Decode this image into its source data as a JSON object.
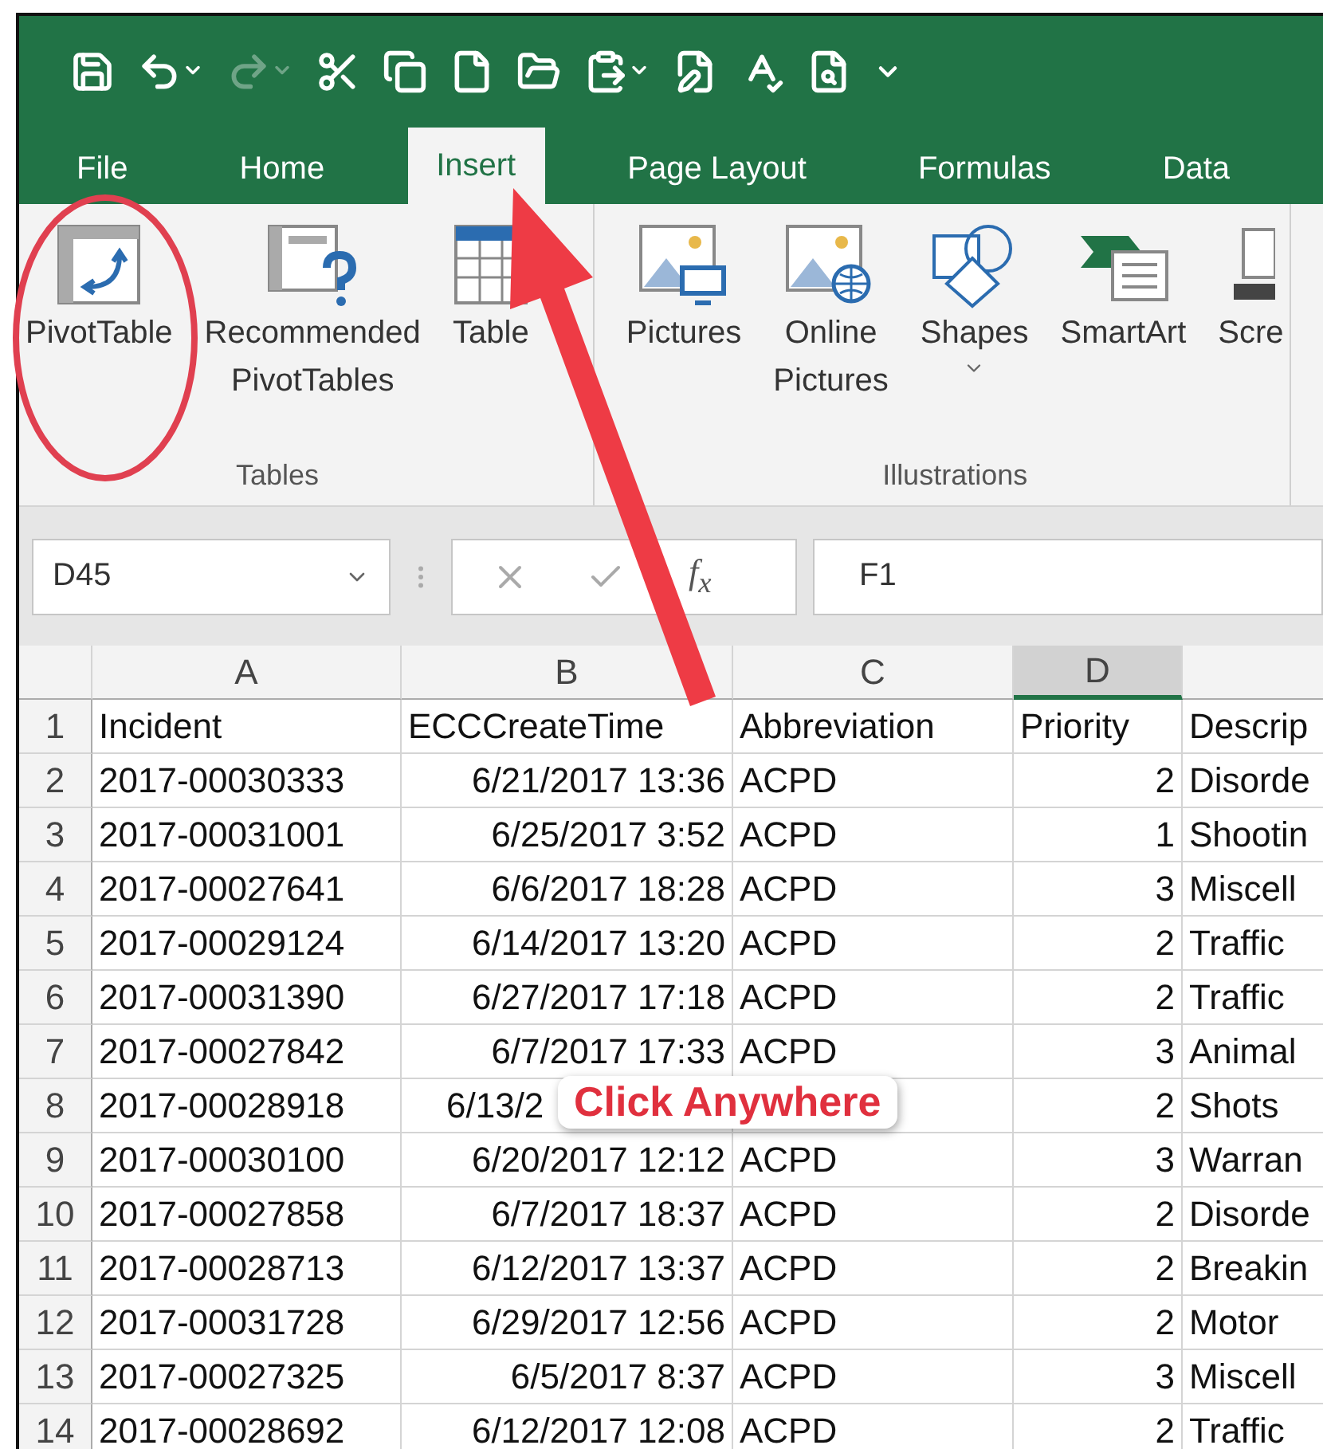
{
  "quick_access": [
    {
      "kind": "save",
      "disabled": false
    },
    {
      "kind": "undo",
      "disabled": false
    },
    {
      "kind": "redo",
      "disabled": true
    },
    {
      "kind": "cut",
      "disabled": false
    },
    {
      "kind": "copy",
      "disabled": false
    },
    {
      "kind": "new",
      "disabled": false
    },
    {
      "kind": "open",
      "disabled": false
    },
    {
      "kind": "paste",
      "disabled": false
    },
    {
      "kind": "form",
      "disabled": false
    },
    {
      "kind": "spelling",
      "disabled": false
    },
    {
      "kind": "preview",
      "disabled": false
    },
    {
      "kind": "customize",
      "disabled": false
    }
  ],
  "tabs": [
    {
      "label": "File",
      "selected": false
    },
    {
      "label": "Home",
      "selected": false
    },
    {
      "label": "Insert",
      "selected": true
    },
    {
      "label": "Page Layout",
      "selected": false
    },
    {
      "label": "Formulas",
      "selected": false
    },
    {
      "label": "Data",
      "selected": false
    }
  ],
  "ribbon": {
    "groups": [
      {
        "label": "Tables",
        "commands": [
          {
            "kind": "pivot",
            "lines": [
              "PivotTable"
            ],
            "dropdown": false
          },
          {
            "kind": "recommended",
            "lines": [
              "Recommended",
              "PivotTables"
            ],
            "dropdown": false
          },
          {
            "kind": "table",
            "lines": [
              "Table"
            ],
            "dropdown": false
          }
        ]
      },
      {
        "label": "Illustrations",
        "commands": [
          {
            "kind": "pictures",
            "lines": [
              "Pictures"
            ],
            "dropdown": false
          },
          {
            "kind": "online",
            "lines": [
              "Online",
              "Pictures"
            ],
            "dropdown": false
          },
          {
            "kind": "shapes",
            "lines": [
              "Shapes"
            ],
            "dropdown": true
          },
          {
            "kind": "smartart",
            "lines": [
              "SmartArt"
            ],
            "dropdown": false
          },
          {
            "kind": "screenshot",
            "lines": [
              "Scre"
            ],
            "dropdown": false
          }
        ]
      }
    ]
  },
  "formula_bar": {
    "name_box": "D45",
    "function_label": "f$_{x}$",
    "value": "F1"
  },
  "sheet": {
    "columns": [
      {
        "label": "A",
        "selected": false
      },
      {
        "label": "B",
        "selected": false
      },
      {
        "label": "C",
        "selected": false
      },
      {
        "label": "D",
        "selected": true
      }
    ],
    "rows": [
      {
        "number": "1",
        "kind": "header",
        "cells": [
          "Incident",
          "ECCCreateTime",
          "Abbreviation",
          "Priority",
          "Descrip"
        ]
      },
      {
        "number": "2",
        "kind": "data",
        "cells": [
          "2017-00030333",
          "6/21/2017 13:36",
          "ACPD",
          "2",
          "Disorde"
        ]
      },
      {
        "number": "3",
        "kind": "data",
        "cells": [
          "2017-00031001",
          "6/25/2017 3:52",
          "ACPD",
          "1",
          "Shootin"
        ]
      },
      {
        "number": "4",
        "kind": "data",
        "cells": [
          "2017-00027641",
          "6/6/2017 18:28",
          "ACPD",
          "3",
          "Miscell"
        ]
      },
      {
        "number": "5",
        "kind": "data",
        "cells": [
          "2017-00029124",
          "6/14/2017 13:20",
          "ACPD",
          "2",
          "Traffic"
        ]
      },
      {
        "number": "6",
        "kind": "data",
        "cells": [
          "2017-00031390",
          "6/27/2017 17:18",
          "ACPD",
          "2",
          "Traffic"
        ]
      },
      {
        "number": "7",
        "kind": "data",
        "cells": [
          "2017-00027842",
          "6/7/2017 17:33",
          "ACPD",
          "3",
          "Animal"
        ]
      },
      {
        "number": "8",
        "kind": "covered",
        "cells": [
          "2017-00028918",
          "6/13/2",
          "",
          "2",
          "Shots"
        ]
      },
      {
        "number": "9",
        "kind": "data",
        "cells": [
          "2017-00030100",
          "6/20/2017 12:12",
          "ACPD",
          "3",
          "Warran"
        ]
      },
      {
        "number": "10",
        "kind": "data",
        "cells": [
          "2017-00027858",
          "6/7/2017 18:37",
          "ACPD",
          "2",
          "Disorde"
        ]
      },
      {
        "number": "11",
        "kind": "data",
        "cells": [
          "2017-00028713",
          "6/12/2017 13:37",
          "ACPD",
          "2",
          "Breakin"
        ]
      },
      {
        "number": "12",
        "kind": "data",
        "cells": [
          "2017-00031728",
          "6/29/2017 12:56",
          "ACPD",
          "2",
          "Motor"
        ]
      },
      {
        "number": "13",
        "kind": "data",
        "cells": [
          "2017-00027325",
          "6/5/2017 8:37",
          "ACPD",
          "3",
          "Miscell"
        ]
      },
      {
        "number": "14",
        "kind": "data",
        "cells": [
          "2017-00028692",
          "6/12/2017 12:08",
          "ACPD",
          "2",
          "Traffic"
        ]
      }
    ]
  },
  "callout": {
    "text": "Click Anywhere"
  }
}
